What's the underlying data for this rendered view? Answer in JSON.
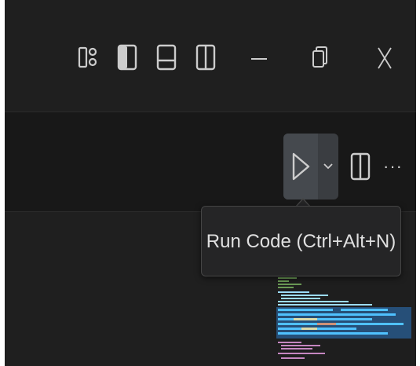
{
  "window_controls": {
    "customize_layout": "customize-layout-icon",
    "toggle_primary_sidebar": "sidebar-left-icon",
    "toggle_panel": "panel-bottom-icon",
    "toggle_secondary_sidebar": "sidebar-right-icon",
    "minimize": "minimize-icon",
    "restore": "restore-icon",
    "close": "close-icon"
  },
  "editor_actions": {
    "run": "play-icon",
    "run_dropdown": "chevron-down-icon",
    "split_editor": "split-editor-icon",
    "more_actions_label": "···"
  },
  "tooltip": {
    "text": "Run Code (Ctrl+Alt+N)"
  },
  "colors": {
    "background": "#1f1f1f",
    "toolbar": "#181818",
    "tooltip_bg": "#252526",
    "tooltip_border": "#454545",
    "icon": "#cccccc",
    "minimap_highlight": "#264f78"
  }
}
